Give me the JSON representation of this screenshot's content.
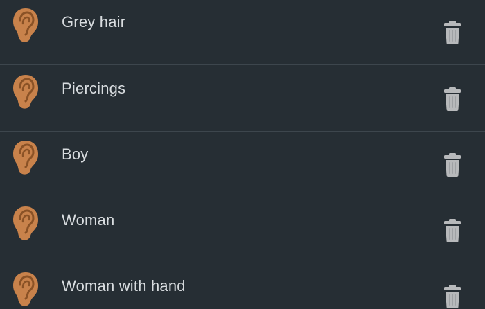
{
  "items": [
    {
      "label": "Grey hair",
      "icon": "ear-icon",
      "action_icon": "trash-icon"
    },
    {
      "label": "Piercings",
      "icon": "ear-icon",
      "action_icon": "trash-icon"
    },
    {
      "label": "Boy",
      "icon": "ear-icon",
      "action_icon": "trash-icon"
    },
    {
      "label": "Woman",
      "icon": "ear-icon",
      "action_icon": "trash-icon"
    },
    {
      "label": "Woman with hand",
      "icon": "ear-icon",
      "action_icon": "trash-icon"
    }
  ],
  "colors": {
    "background": "#262e34",
    "divider": "#3d464d",
    "text": "#d8dcdf",
    "ear": "#c8824b",
    "ear_inner": "#8a5226",
    "trash": "#b7b9bb"
  }
}
